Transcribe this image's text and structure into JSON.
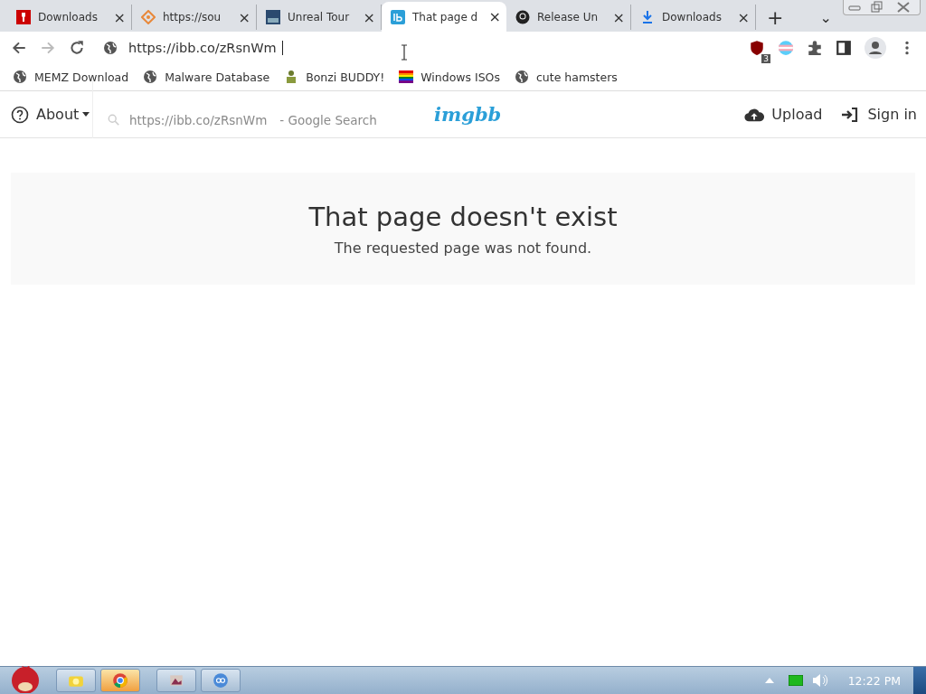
{
  "tabs": [
    {
      "title": "Downloads",
      "selected": false
    },
    {
      "title": "https://sou",
      "selected": false
    },
    {
      "title": "Unreal Tour",
      "selected": false
    },
    {
      "title": "That page d",
      "selected": true
    },
    {
      "title": "Release Un",
      "selected": false
    },
    {
      "title": "Downloads",
      "selected": false
    }
  ],
  "tab_close": "×",
  "new_tab": "+",
  "tab_menu": "⌄",
  "address_bar": {
    "value": "https://ibb.co/zRsnWm"
  },
  "extension_badge": "3",
  "bookmarks": [
    {
      "label": "MEMZ Download"
    },
    {
      "label": "Malware Database"
    },
    {
      "label": "Bonzi BUDDY!"
    },
    {
      "label": "Windows ISOs"
    },
    {
      "label": "cute hamsters"
    }
  ],
  "suggestion": {
    "query": "https://ibb.co/zRsnWm",
    "suffix": "- Google Search"
  },
  "site_header": {
    "about": "About",
    "logo": "imgbb",
    "upload": "Upload",
    "sign_in": "Sign in"
  },
  "error": {
    "title": "That page doesn't exist",
    "message": "The requested page was not found."
  },
  "taskbar": {
    "apps": [
      {
        "selected": false
      },
      {
        "selected": true
      },
      {
        "selected": false
      },
      {
        "selected": false
      }
    ],
    "clock": "12:22 PM"
  }
}
